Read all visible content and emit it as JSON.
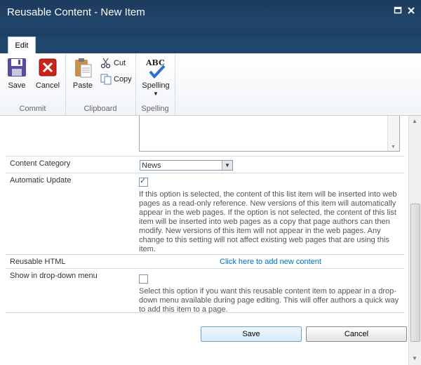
{
  "dialog": {
    "title": "Reusable Content - New Item"
  },
  "ribbon": {
    "tab_edit": "Edit",
    "groups": {
      "commit": "Commit",
      "clipboard": "Clipboard",
      "spelling": "Spelling"
    },
    "buttons": {
      "save": "Save",
      "cancel": "Cancel",
      "paste": "Paste",
      "cut": "Cut",
      "copy": "Copy",
      "spelling": "Spelling",
      "spelling_icon_text": "ABC"
    }
  },
  "form": {
    "content_category": {
      "label": "Content Category",
      "value": "News"
    },
    "automatic_update": {
      "label": "Automatic Update",
      "checked": true,
      "description": "If this option is selected, the content of this list item will be inserted into web pages as a read-only reference. New versions of this item will automatically appear in the web pages. If the option is not selected, the content of this list item will be inserted into web pages as a copy that page authors can then modify. New versions of this item will not appear in the web pages. Any change to this setting will not affect existing web pages that are using this item."
    },
    "reusable_html": {
      "label": "Reusable HTML",
      "link": "Click here to add new content"
    },
    "show_in_dropdown": {
      "label": "Show in drop-down menu",
      "checked": false,
      "description": "Select this option if you want this reusable content item to appear in a drop-down menu available during page editing. This will offer authors a quick way to add this item to a page."
    },
    "buttons": {
      "save": "Save",
      "cancel": "Cancel"
    }
  }
}
